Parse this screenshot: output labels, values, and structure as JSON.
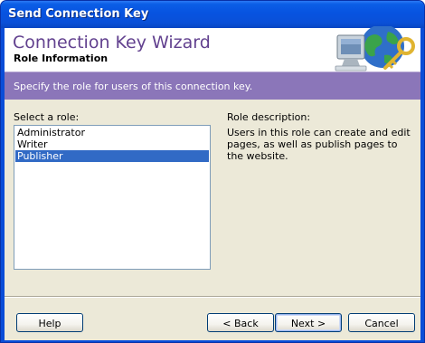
{
  "window": {
    "title": "Send Connection Key"
  },
  "header": {
    "title": "Connection Key Wizard",
    "subtitle": "Role Information"
  },
  "instruction": "Specify the role for users of this connection key.",
  "roles": {
    "label": "Select a role:",
    "items": [
      "Administrator",
      "Writer",
      "Publisher"
    ],
    "selected": "Publisher"
  },
  "description": {
    "label": "Role description:",
    "text": "Users in this role can create and edit pages, as well as publish pages to the website."
  },
  "buttons": {
    "help": "Help",
    "back": "< Back",
    "next": "Next >",
    "cancel": "Cancel"
  },
  "colors": {
    "title_bar": "#0a50d8",
    "header_title": "#62418f",
    "instruction_band": "#8b76b9",
    "selection": "#316ac5",
    "dialog_face": "#ece9d8"
  },
  "icons": {
    "header_art": "computer-globe-key-icon"
  }
}
